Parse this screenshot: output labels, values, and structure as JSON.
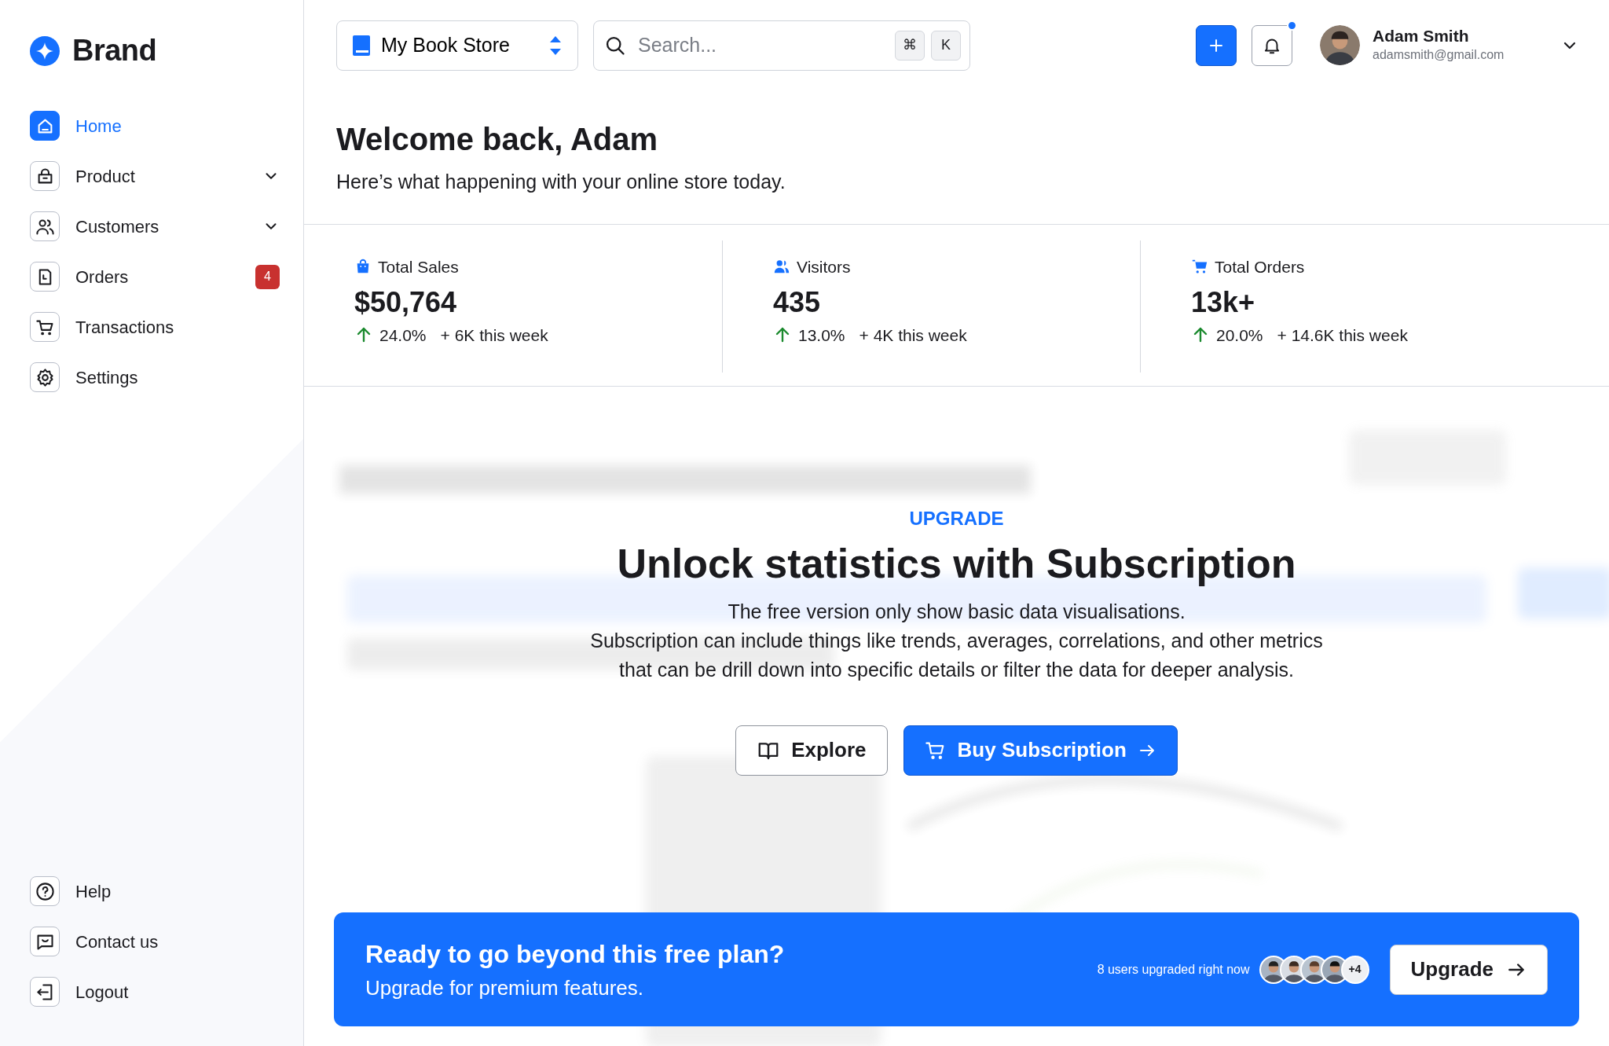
{
  "brand": {
    "name": "Brand"
  },
  "sidebar": {
    "items": [
      {
        "label": "Home",
        "selected": true,
        "expandable": false
      },
      {
        "label": "Product",
        "selected": false,
        "expandable": true
      },
      {
        "label": "Customers",
        "selected": false,
        "expandable": true
      },
      {
        "label": "Orders",
        "selected": false,
        "expandable": false,
        "badge": "4"
      },
      {
        "label": "Transactions",
        "selected": false,
        "expandable": false
      },
      {
        "label": "Settings",
        "selected": false,
        "expandable": false
      }
    ],
    "footer_items": [
      {
        "label": "Help"
      },
      {
        "label": "Contact us"
      },
      {
        "label": "Logout"
      }
    ]
  },
  "header": {
    "store": "My Book Store",
    "search": {
      "placeholder": "Search...",
      "keys": [
        "⌘",
        "K"
      ]
    },
    "notifications": {
      "unread": true
    },
    "user": {
      "name": "Adam Smith",
      "email": "adamsmith@gmail.com"
    }
  },
  "welcome": {
    "title": "Welcome back, Adam",
    "subtitle": "Here’s what happening with your online store today."
  },
  "stats": [
    {
      "label": "Total Sales",
      "value": "$50,764",
      "change": "24.0%",
      "week": "+ 6K this week"
    },
    {
      "label": "Visitors",
      "value": "435",
      "change": "13.0%",
      "week": "+ 4K this week"
    },
    {
      "label": "Total Orders",
      "value": "13k+",
      "change": "20.0%",
      "week": "+ 14.6K this week"
    }
  ],
  "upgrade_panel": {
    "eyebrow": "UPGRADE",
    "title": "Unlock statistics with Subscription",
    "lines": [
      "The free version only show basic data visualisations.",
      "Subscription can include things like trends, averages, correlations, and other metrics",
      "that can be drill down into specific details or filter the data for deeper analysis."
    ],
    "buttons": [
      {
        "kind": "outline",
        "label": "Explore"
      },
      {
        "kind": "primary",
        "label": "Buy Subscription"
      }
    ]
  },
  "banner": {
    "title": "Ready to go beyond this free plan?",
    "subtitle": "Upgrade for premium features.",
    "social_proof": "8 users upgraded right now",
    "more_users": "+4",
    "button": "Upgrade"
  }
}
